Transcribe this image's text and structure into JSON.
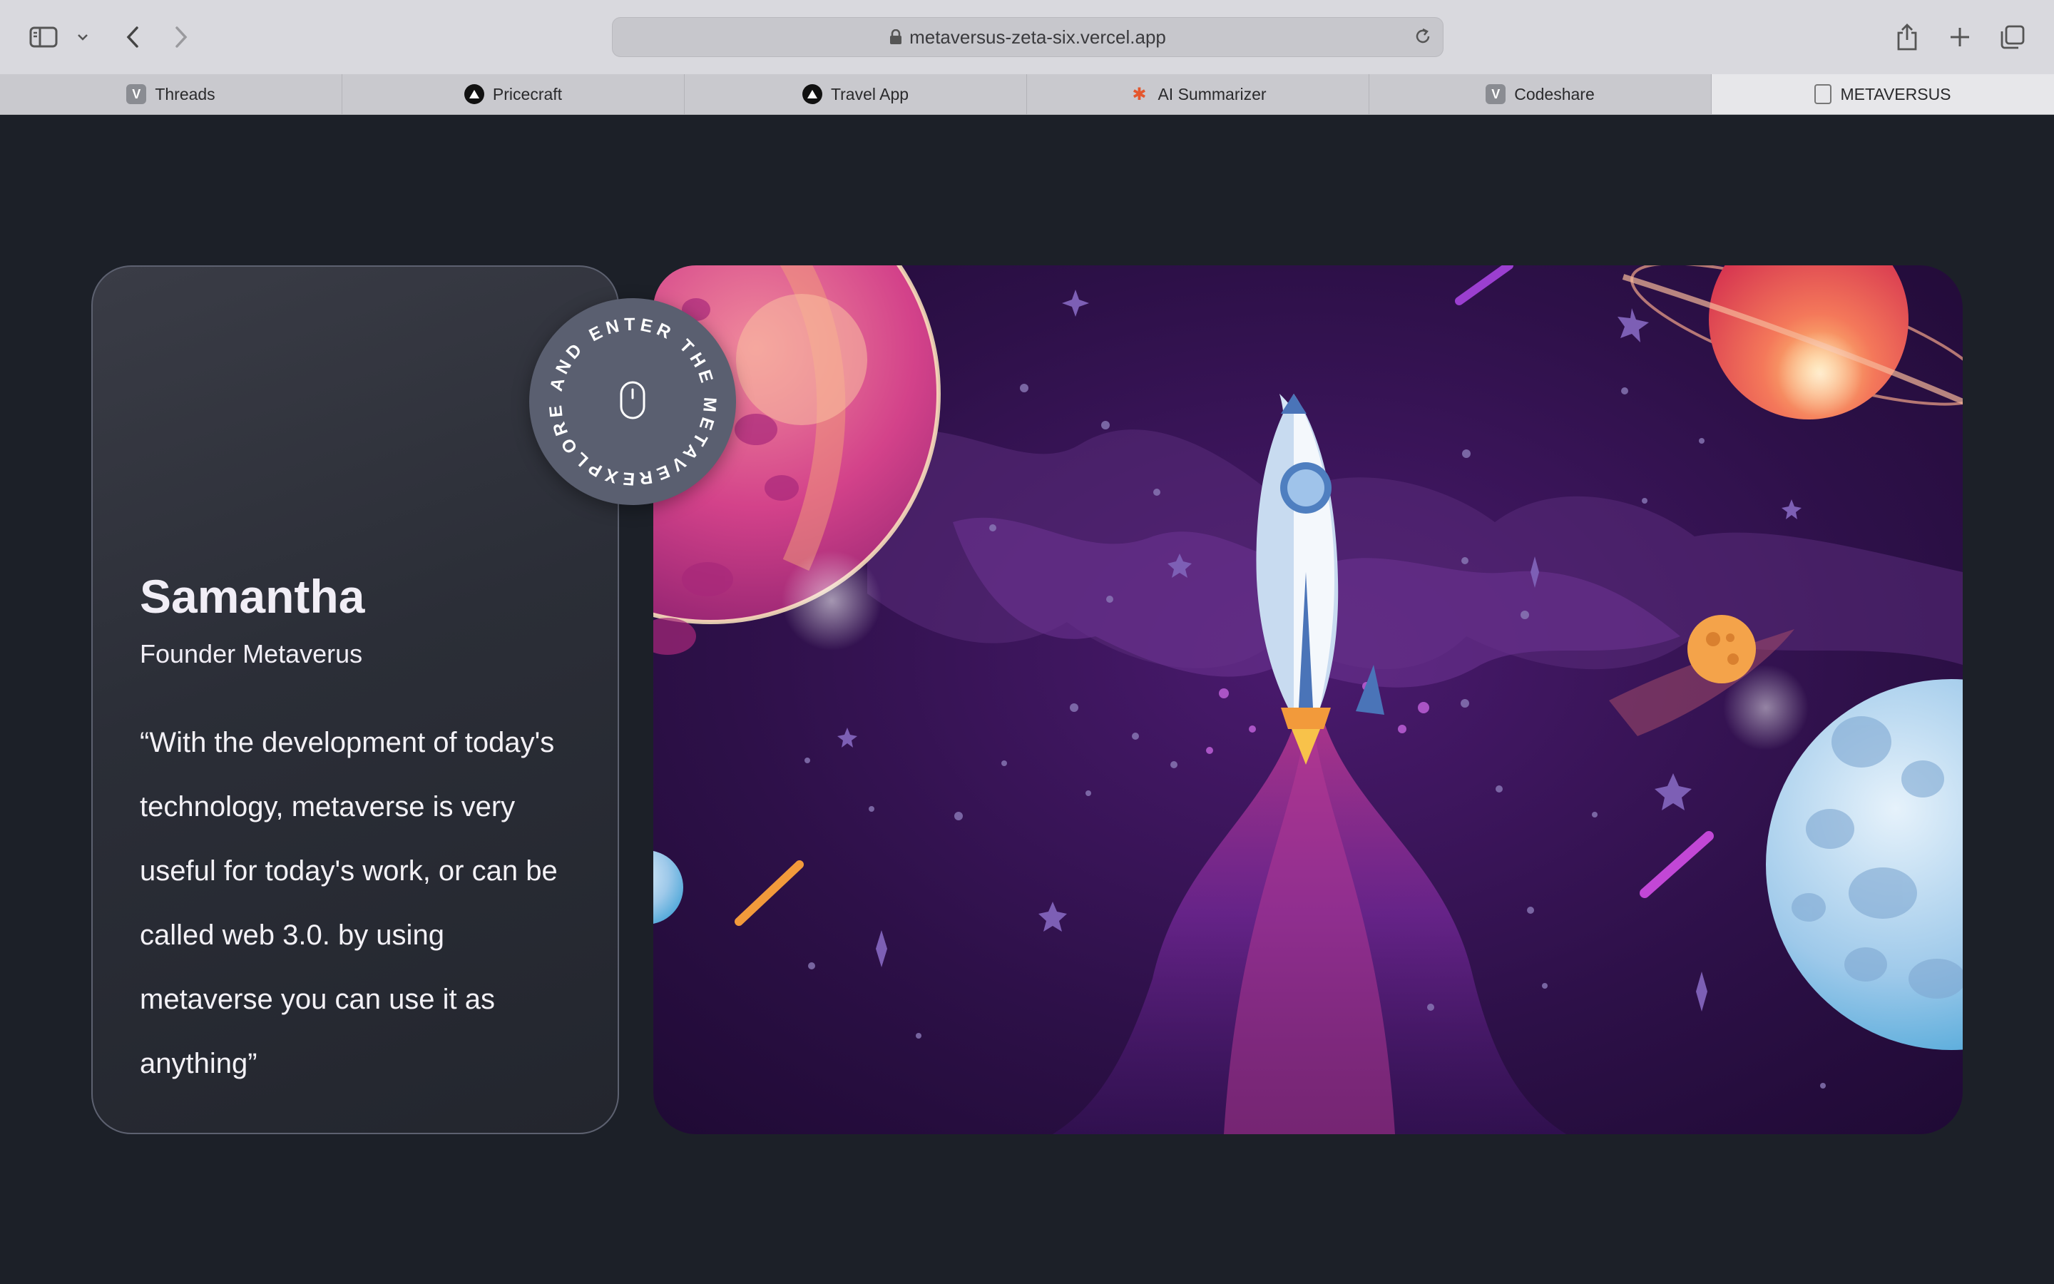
{
  "browser": {
    "url": "metaversus-zeta-six.vercel.app",
    "tabs": [
      {
        "label": "Threads",
        "icon": "v-logo-icon"
      },
      {
        "label": "Pricecraft",
        "icon": "triangle-logo-icon"
      },
      {
        "label": "Travel App",
        "icon": "triangle-logo-icon"
      },
      {
        "label": "AI Summarizer",
        "icon": "gear-logo-icon"
      },
      {
        "label": "Codeshare",
        "icon": "v-logo-icon"
      },
      {
        "label": "METAVERSUS",
        "icon": "metaversus-logo-icon",
        "active": true
      }
    ]
  },
  "testimonial": {
    "name": "Samantha",
    "role": "Founder Metaverus",
    "quote": "“With the development of today's technology, metaverse is very useful for today's work, or can be called web 3.0. by using metaverse you can use it as anything”"
  },
  "badge": {
    "text": "EXPLORE AND ENTER THE METAVERSE",
    "icon": "mouse-icon"
  },
  "colors": {
    "page_bg": "#1c2028",
    "scene_bg": "#2a0f45",
    "accent_pink": "#c13a8d"
  }
}
